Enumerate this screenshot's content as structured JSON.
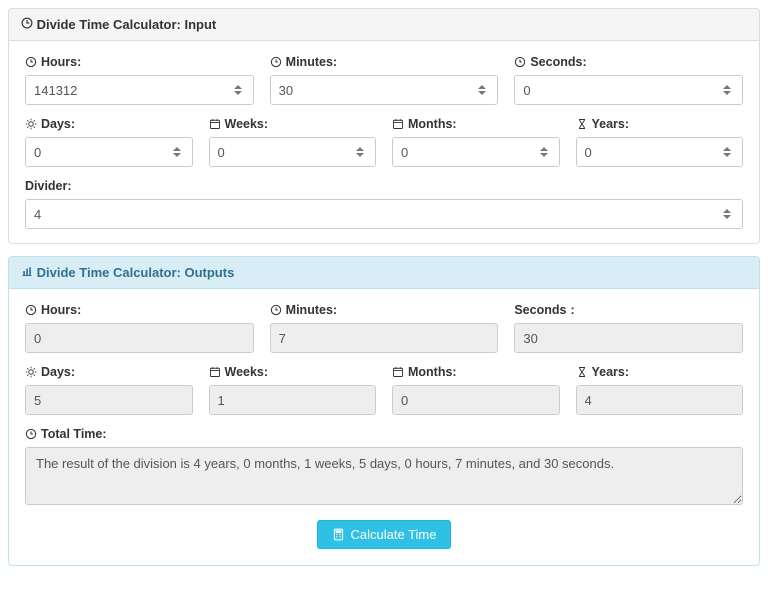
{
  "input_panel": {
    "title": "Divide Time Calculator: Input",
    "hours_label": "Hours:",
    "minutes_label": "Minutes:",
    "seconds_label": "Seconds:",
    "days_label": "Days:",
    "weeks_label": "Weeks:",
    "months_label": "Months:",
    "years_label": "Years:",
    "divider_label": "Divider:",
    "hours": "141312",
    "minutes": "30",
    "seconds": "0",
    "days": "0",
    "weeks": "0",
    "months": "0",
    "years": "0",
    "divider": "4"
  },
  "output_panel": {
    "title": "Divide Time Calculator: Outputs",
    "hours_label": "Hours:",
    "minutes_label": "Minutes:",
    "seconds_label": "Seconds",
    "days_label": "Days:",
    "weeks_label": "Weeks:",
    "months_label": "Months:",
    "years_label": "Years:",
    "total_label": "Total Time:",
    "hours": "0",
    "minutes": "7",
    "seconds": "30",
    "days": "5",
    "weeks": "1",
    "months": "0",
    "years": "4",
    "total": "The result of the division is 4 years, 0 months, 1 weeks, 5 days, 0 hours, 7 minutes, and 30 seconds."
  },
  "button": {
    "label": "Calculate Time"
  }
}
